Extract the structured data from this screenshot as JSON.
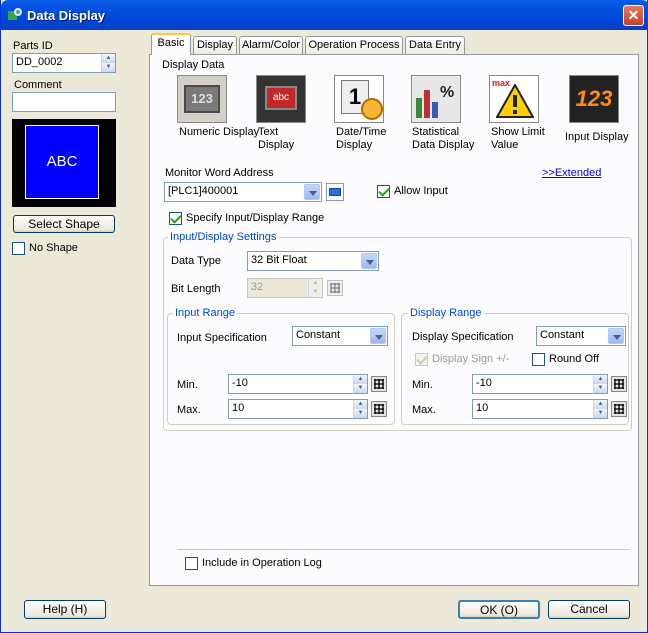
{
  "window": {
    "title": "Data Display",
    "close": "✕"
  },
  "left": {
    "parts_id_label": "Parts ID",
    "parts_id_value": "DD_0002",
    "comment_label": "Comment",
    "comment_value": "",
    "preview_text": "ABC",
    "select_shape": "Select Shape",
    "no_shape": "No Shape"
  },
  "tabs": [
    "Basic",
    "Display",
    "Alarm/Color",
    "Operation Process",
    "Data Entry"
  ],
  "basic": {
    "display_data_label": "Display Data",
    "types": [
      {
        "icon": "numeric-display-icon",
        "label": "Numeric Display"
      },
      {
        "icon": "text-display-icon",
        "label": "Text Display"
      },
      {
        "icon": "datetime-display-icon",
        "label": "Date/Time Display"
      },
      {
        "icon": "statistical-display-icon",
        "label": "Statistical Data Display"
      },
      {
        "icon": "show-limit-icon",
        "label": "Show Limit Value"
      },
      {
        "icon": "input-display-icon",
        "label": "Input Display"
      }
    ],
    "icon_glyphs": {
      "numeric": "123",
      "text": "abc",
      "datetime": "1",
      "statistical": "%",
      "showlimit": "max",
      "input": "123"
    },
    "monitor_label": "Monitor Word Address",
    "extended": ">>Extended",
    "monitor_value": "[PLC1]400001",
    "allow_input": "Allow Input",
    "specify_range": "Specify Input/Display Range",
    "settings_title": "Input/Display Settings",
    "data_type_label": "Data Type",
    "data_type_value": "32 Bit Float",
    "bit_length_label": "Bit Length",
    "bit_length_value": "32",
    "input_range": {
      "title": "Input Range",
      "spec_label": "Input Specification",
      "spec_value": "Constant",
      "min_label": "Min.",
      "min_value": "-10",
      "max_label": "Max.",
      "max_value": "10"
    },
    "display_range": {
      "title": "Display Range",
      "spec_label": "Display Specification",
      "spec_value": "Constant",
      "sign_label": "Display Sign +/-",
      "round_label": "Round Off",
      "min_label": "Min.",
      "min_value": "-10",
      "max_label": "Max.",
      "max_value": "10"
    },
    "include_log": "Include in Operation Log"
  },
  "footer": {
    "help": "Help (H)",
    "ok": "OK (O)",
    "cancel": "Cancel"
  }
}
